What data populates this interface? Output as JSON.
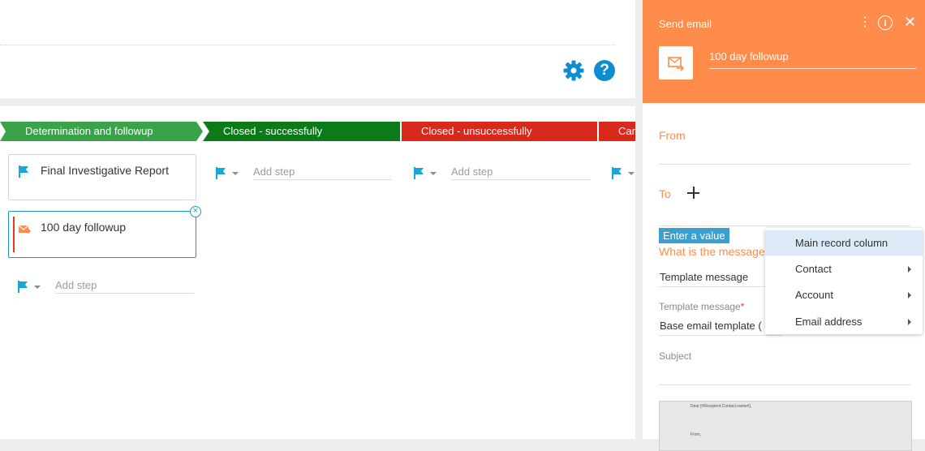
{
  "colors": {
    "accent": "#ff8c4a",
    "link_blue": "#0e8ed1",
    "stage_green": "#3aa34a",
    "stage_dark_green": "#0c7a18",
    "stage_red": "#d9291c"
  },
  "header": {
    "gear_icon": "gear-icon",
    "help_icon": "question-mark-icon",
    "help_label": "?"
  },
  "stages": [
    {
      "label": "Determination and followup"
    },
    {
      "label": "Closed - successfully"
    },
    {
      "label": "Closed - unsuccessfully"
    },
    {
      "label": "Can"
    }
  ],
  "cards": [
    {
      "title": "Final Investigative Report",
      "icon": "flag-icon"
    },
    {
      "title": "100 day followup",
      "icon": "send-email-icon"
    }
  ],
  "add_step_label": "Add step",
  "panel": {
    "title": "Send email",
    "kebab": "⋮",
    "info": "i",
    "close": "✕",
    "step_name": "100 day followup",
    "from_label": "From",
    "to_label": "To",
    "enter_value_chip": "Enter a value",
    "message_question": "What is the message",
    "message_value": "Template message",
    "template_label": "Template message",
    "template_required": "*",
    "template_value": "Base email template (",
    "subject_label": "Subject",
    "preview_line1": "Dear [#Recipient.Contact.name#],",
    "preview_line2": "From,"
  },
  "menu": {
    "items": [
      {
        "label": "Main record column",
        "has_submenu": false
      },
      {
        "label": "Contact",
        "has_submenu": true
      },
      {
        "label": "Account",
        "has_submenu": true
      },
      {
        "label": "Email address",
        "has_submenu": true
      }
    ]
  }
}
